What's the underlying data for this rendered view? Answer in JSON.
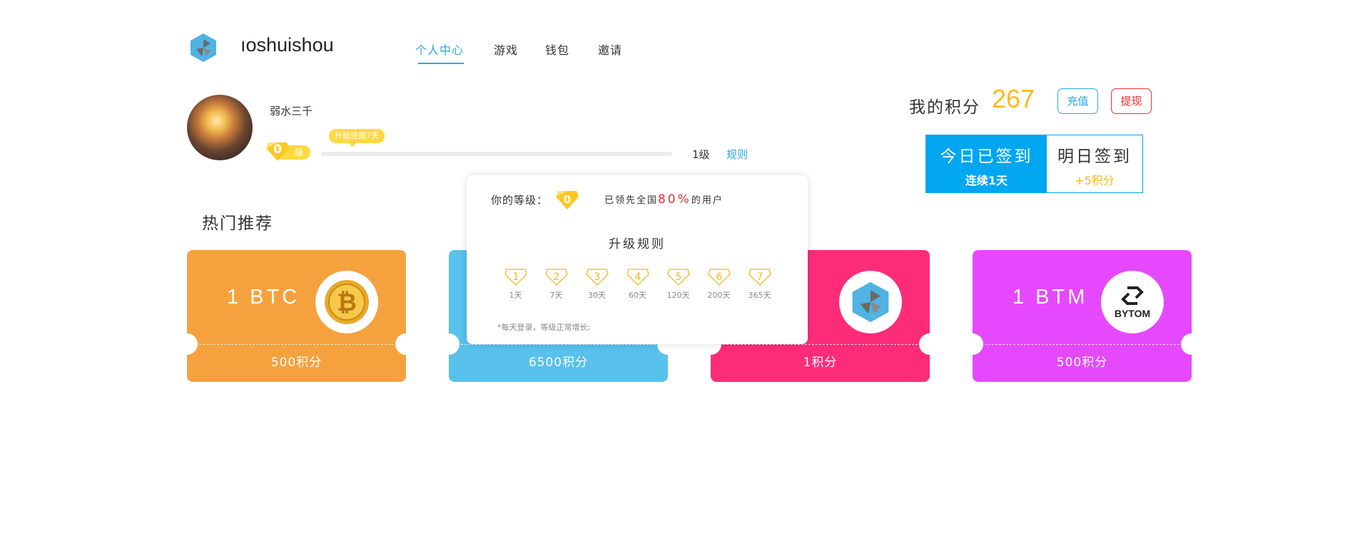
{
  "header": {
    "logo_text": "ıoshuishou",
    "nav": [
      {
        "label": "个人中心",
        "active": true
      },
      {
        "label": "游戏",
        "active": false
      },
      {
        "label": "钱包",
        "active": false
      },
      {
        "label": "邀请",
        "active": false
      }
    ]
  },
  "user": {
    "name": "弱水三千",
    "level": "0",
    "level_suffix": "级",
    "upgrade_tip": "升级还需7天",
    "progress": 0,
    "next_level": "1级",
    "rules_link": "规则"
  },
  "points": {
    "label": "我的积分",
    "value": "267",
    "recharge": "充值",
    "withdraw": "提现"
  },
  "signin": {
    "today_title": "今日已签到",
    "today_sub": "连续1天",
    "tomorrow_title": "明日签到",
    "tomorrow_sub": "+5积分"
  },
  "hot": {
    "title": "热门推荐",
    "cards": [
      {
        "coin": "1  BTC",
        "price": "500积分",
        "color": "#f5a23e",
        "icon": "bitcoin-icon"
      },
      {
        "coin": "",
        "price": "6500积分",
        "color": "#58c1ec",
        "icon": ""
      },
      {
        "coin": "",
        "price": "1积分",
        "color": "#fd2c79",
        "icon": "app-logo-icon"
      },
      {
        "coin": "1  BTM",
        "price": "500积分",
        "color": "#e648fe",
        "icon": "bytom-icon",
        "icon_text": "BYTOM"
      }
    ]
  },
  "popup": {
    "your_level_label": "你的等级：",
    "level": "0",
    "lead_prefix": "已领先全国",
    "lead_pct": "80%",
    "lead_suffix": "的用户",
    "upgrade_title": "升级规则",
    "levels": [
      {
        "num": "1",
        "days": "1天"
      },
      {
        "num": "2",
        "days": "7天"
      },
      {
        "num": "3",
        "days": "30天"
      },
      {
        "num": "4",
        "days": "60天"
      },
      {
        "num": "5",
        "days": "120天"
      },
      {
        "num": "6",
        "days": "200天"
      },
      {
        "num": "7",
        "days": "365天"
      }
    ],
    "note": "*每天登录，等级正常增长;"
  },
  "colors": {
    "accent": "#2aa7e8",
    "gold": "#ffd843",
    "points": "#ffb91b",
    "danger": "#f02d2d"
  }
}
